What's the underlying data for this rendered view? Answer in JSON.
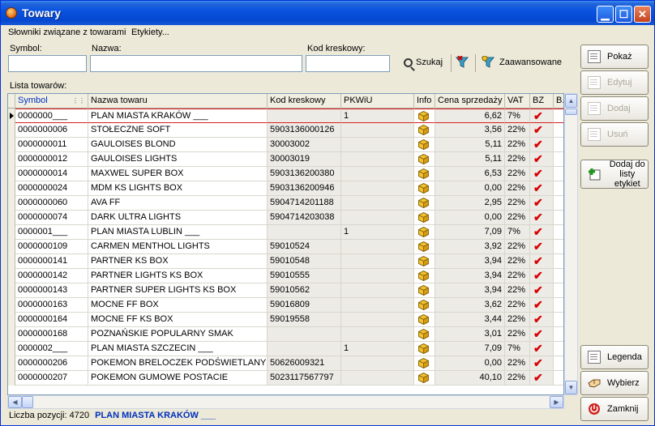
{
  "window": {
    "title": "Towary"
  },
  "menu": {
    "items": [
      "Słowniki związane z towarami",
      "Etykiety..."
    ]
  },
  "filters": {
    "symbol_label": "Symbol:",
    "symbol_value": "",
    "name_label": "Nazwa:",
    "name_value": "",
    "barcode_label": "Kod kreskowy:",
    "barcode_value": "",
    "search_label": "Szukaj",
    "advanced_label": "Zaawansowane"
  },
  "list": {
    "label": "Lista towarów:",
    "columns": [
      "Symbol",
      "Nazwa towaru",
      "Kod kreskowy",
      "PKWiU",
      "Info",
      "Cena sprzedaży",
      "VAT",
      "BZ",
      "B."
    ],
    "rows": [
      {
        "symbol": "0000000___",
        "name": "PLAN MIASTA KRAKÓW ___",
        "barcode": "",
        "pkwiu": "1",
        "price": "6,62",
        "vat": "7%"
      },
      {
        "symbol": "0000000006",
        "name": "STOŁECZNE SOFT",
        "barcode": "5903136000126",
        "pkwiu": "",
        "price": "3,56",
        "vat": "22%"
      },
      {
        "symbol": "0000000011",
        "name": "GAULOISES BLOND",
        "barcode": "30003002",
        "pkwiu": "",
        "price": "5,11",
        "vat": "22%"
      },
      {
        "symbol": "0000000012",
        "name": "GAULOISES LIGHTS",
        "barcode": "30003019",
        "pkwiu": "",
        "price": "5,11",
        "vat": "22%"
      },
      {
        "symbol": "0000000014",
        "name": "MAXWEL SUPER BOX",
        "barcode": "5903136200380",
        "pkwiu": "",
        "price": "6,53",
        "vat": "22%"
      },
      {
        "symbol": "0000000024",
        "name": "MDM KS LIGHTS BOX",
        "barcode": "5903136200946",
        "pkwiu": "",
        "price": "0,00",
        "vat": "22%"
      },
      {
        "symbol": "0000000060",
        "name": "AVA FF",
        "barcode": "5904714201188",
        "pkwiu": "",
        "price": "2,95",
        "vat": "22%"
      },
      {
        "symbol": "0000000074",
        "name": "DARK ULTRA LIGHTS",
        "barcode": "5904714203038",
        "pkwiu": "",
        "price": "0,00",
        "vat": "22%"
      },
      {
        "symbol": "0000001___",
        "name": "PLAN MIASTA LUBLIN ___",
        "barcode": "",
        "pkwiu": "1",
        "price": "7,09",
        "vat": "7%"
      },
      {
        "symbol": "0000000109",
        "name": "CARMEN MENTHOL LIGHTS",
        "barcode": "59010524",
        "pkwiu": "",
        "price": "3,92",
        "vat": "22%"
      },
      {
        "symbol": "0000000141",
        "name": "PARTNER KS BOX",
        "barcode": "59010548",
        "pkwiu": "",
        "price": "3,94",
        "vat": "22%"
      },
      {
        "symbol": "0000000142",
        "name": "PARTNER LIGHTS KS BOX",
        "barcode": "59010555",
        "pkwiu": "",
        "price": "3,94",
        "vat": "22%"
      },
      {
        "symbol": "0000000143",
        "name": "PARTNER SUPER LIGHTS KS BOX",
        "barcode": "59010562",
        "pkwiu": "",
        "price": "3,94",
        "vat": "22%"
      },
      {
        "symbol": "0000000163",
        "name": "MOCNE FF BOX",
        "barcode": "59016809",
        "pkwiu": "",
        "price": "3,62",
        "vat": "22%"
      },
      {
        "symbol": "0000000164",
        "name": "MOCNE FF KS BOX",
        "barcode": "59019558",
        "pkwiu": "",
        "price": "3,44",
        "vat": "22%"
      },
      {
        "symbol": "0000000168",
        "name": "POZNAŃSKIE POPULARNY SMAK",
        "barcode": "",
        "pkwiu": "",
        "price": "3,01",
        "vat": "22%"
      },
      {
        "symbol": "0000002___",
        "name": "PLAN MIASTA SZCZECIN ___",
        "barcode": "",
        "pkwiu": "1",
        "price": "7,09",
        "vat": "7%"
      },
      {
        "symbol": "0000000206",
        "name": "POKEMON BRELOCZEK PODŚWIETLANY",
        "barcode": "50626009321",
        "pkwiu": "",
        "price": "0,00",
        "vat": "22%"
      },
      {
        "symbol": "0000000207",
        "name": "POKEMON GUMOWE POSTACIE",
        "barcode": "5023117567797",
        "pkwiu": "",
        "price": "40,10",
        "vat": "22%"
      }
    ]
  },
  "buttons": {
    "show": "Pokaż",
    "edit": "Edytuj",
    "add": "Dodaj",
    "delete": "Usuń",
    "add_to_labels": "Dodaj do listy etykiet",
    "legend": "Legenda",
    "choose": "Wybierz",
    "close": "Zamknij"
  },
  "status": {
    "count_text": "Liczba pozycji: 4720",
    "current_name": "PLAN MIASTA KRAKÓW ___"
  }
}
